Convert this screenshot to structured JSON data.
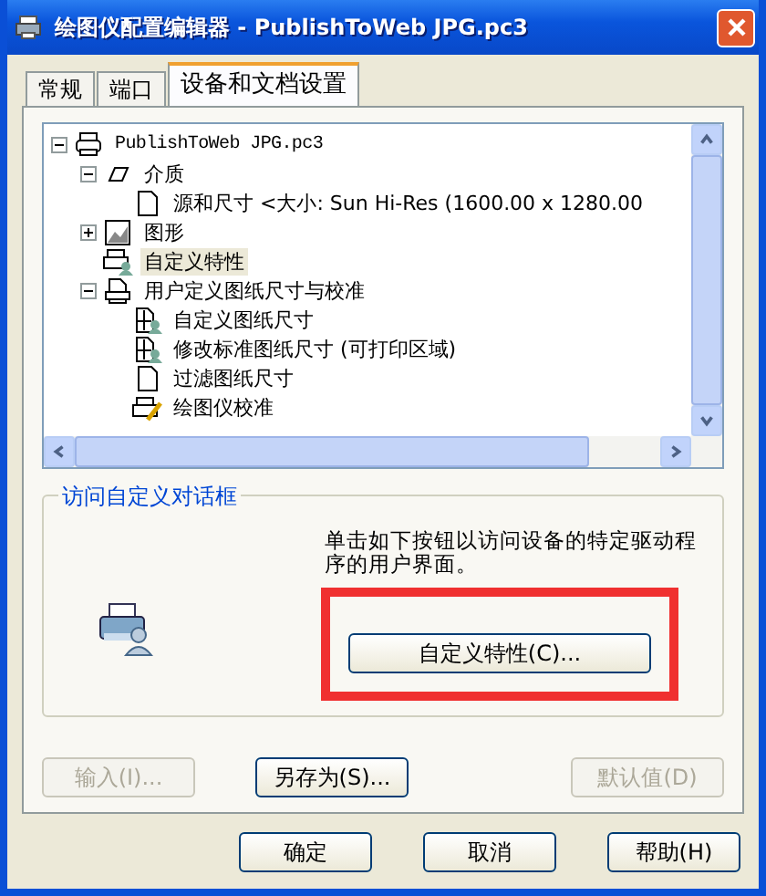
{
  "window": {
    "title": "绘图仪配置编辑器 - PublishToWeb JPG.pc3"
  },
  "tabs": [
    {
      "label": "常规",
      "selected": false
    },
    {
      "label": "端口",
      "selected": false
    },
    {
      "label": "设备和文档设置",
      "selected": true
    }
  ],
  "tree": [
    {
      "label": "PublishToWeb JPG.pc3",
      "kind": "plotter",
      "selected": false,
      "expanded": true,
      "children": [
        {
          "label": "介质",
          "kind": "media",
          "selected": false,
          "expanded": true,
          "children": [
            {
              "label": "源和尺寸 <大小: Sun Hi-Res (1600.00 x 1280.00",
              "kind": "sheet",
              "selected": false
            }
          ]
        },
        {
          "label": "图形",
          "kind": "graphics",
          "selected": false,
          "expanded": false
        },
        {
          "label": "自定义特性",
          "kind": "custom",
          "selected": true
        },
        {
          "label": "用户定义图纸尺寸与校准",
          "kind": "paper",
          "selected": false,
          "expanded": true,
          "children": [
            {
              "label": "自定义图纸尺寸",
              "kind": "papersize",
              "selected": false
            },
            {
              "label": "修改标准图纸尺寸 (可打印区域)",
              "kind": "papersize",
              "selected": false
            },
            {
              "label": "过滤图纸尺寸",
              "kind": "sheet",
              "selected": false
            },
            {
              "label": "绘图仪校准",
              "kind": "calibrate",
              "selected": false
            }
          ]
        }
      ]
    }
  ],
  "group": {
    "title": "访问自定义对话框",
    "description": "单击如下按钮以访问设备的特定驱动程序的用户界面。",
    "button": "自定义特性(C)..."
  },
  "panel_buttons": [
    {
      "label": "输入(I)...",
      "disabled": true
    },
    {
      "label": "另存为(S)...",
      "disabled": false
    },
    {
      "label": "默认值(D)",
      "disabled": true
    }
  ],
  "dialog_buttons": [
    "确定",
    "取消",
    "帮助(H)"
  ]
}
